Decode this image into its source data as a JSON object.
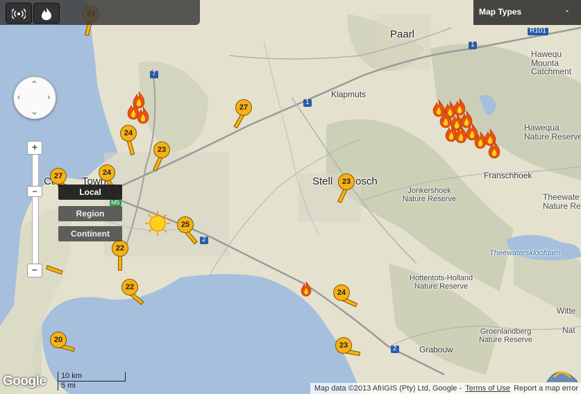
{
  "toolbar": {
    "signal_icon": "wifi-signal-icon",
    "fire_icon": "flame-icon"
  },
  "map_types": {
    "label": "Map Types",
    "chevron": "-"
  },
  "nav": {
    "zoom_in": "+",
    "zoom_out": "−",
    "scale_options": [
      "Local",
      "Region",
      "Continent"
    ],
    "active_scale": "Local"
  },
  "places": {
    "paarl": "Paarl",
    "klapmuts": "Klapmuts",
    "stellenbosch_left": "Stell",
    "stellenbosch_right": "osch",
    "franschhoek": "Franschhoek",
    "cape_town_left": "Cap",
    "cape_town_right": "Town",
    "grabouw": "Grabouw",
    "jonkershoek": "Jonkershoek\nNature Reserve",
    "hottentots": "Hottentots-Holland\nNature Reserve",
    "groenlandberg": "Groenlandberg\nNature Reserve",
    "hawequas_mountain": "Hawequ\nMounta\nCatchment",
    "hawequas_nature": "Hawequa\nNature Reserve",
    "theewaters_nature": "Theewate\nNature Res",
    "theewaterskloofdam": "Theewaterskloofdam",
    "witte": "Witte",
    "nat": "Nat"
  },
  "route_shields": [
    "R101",
    "1",
    "1",
    "7",
    "M5",
    "2",
    "2"
  ],
  "weather_markers": [
    {
      "temp": "24"
    },
    {
      "temp": "27"
    },
    {
      "temp": "24"
    },
    {
      "temp": "23"
    },
    {
      "temp": "27"
    },
    {
      "temp": "24"
    },
    {
      "temp": "23"
    },
    {
      "temp": "25"
    },
    {
      "temp": "22"
    },
    {
      "temp": "22"
    },
    {
      "temp": "24"
    },
    {
      "temp": "20"
    },
    {
      "temp": "23"
    }
  ],
  "attribution": {
    "text": "Map data ©2013 AfriGIS (Pty) Ltd, Google -",
    "terms": "Terms of Use",
    "report": "Report a map error"
  },
  "scale": {
    "km": "10 km",
    "mi": "5 mi"
  },
  "logo": "Google",
  "colors": {
    "land": "#e4e2cf",
    "water": "#a5bfdd",
    "marker": "#f7b016",
    "fire": "#e8520f"
  }
}
